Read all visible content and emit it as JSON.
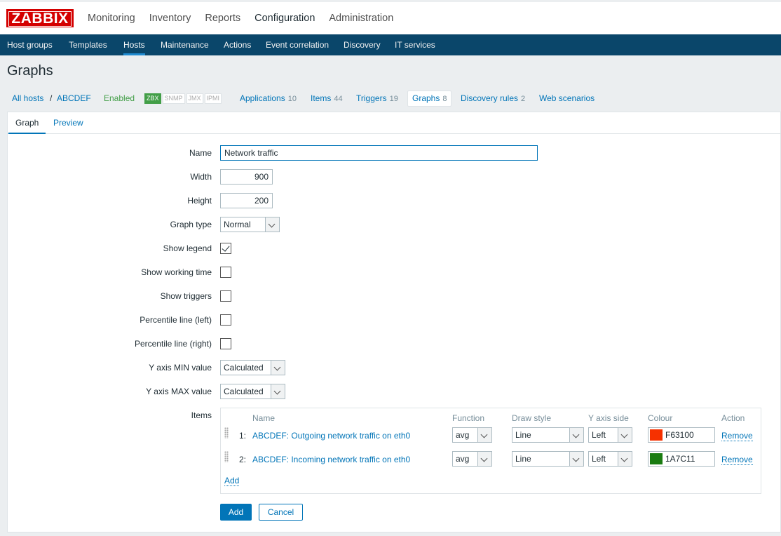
{
  "logo": "ZABBIX",
  "main_menu": [
    "Monitoring",
    "Inventory",
    "Reports",
    "Configuration",
    "Administration"
  ],
  "sub_menu": [
    "Host groups",
    "Templates",
    "Hosts",
    "Maintenance",
    "Actions",
    "Event correlation",
    "Discovery",
    "IT services"
  ],
  "page_title": "Graphs",
  "host_nav": {
    "all_hosts": "All hosts",
    "separator": "/",
    "host": "ABCDEF",
    "status": "Enabled",
    "badges": [
      "ZBX",
      "SNMP",
      "JMX",
      "IPMI"
    ],
    "applications": {
      "label": "Applications",
      "count": "10"
    },
    "items": {
      "label": "Items",
      "count": "44"
    },
    "triggers": {
      "label": "Triggers",
      "count": "19"
    },
    "graphs": {
      "label": "Graphs",
      "count": "8"
    },
    "discovery": {
      "label": "Discovery rules",
      "count": "2"
    },
    "web": {
      "label": "Web scenarios"
    }
  },
  "tabs": [
    "Graph",
    "Preview"
  ],
  "form": {
    "name_label": "Name",
    "name_value": "Network traffic",
    "width_label": "Width",
    "width_value": "900",
    "height_label": "Height",
    "height_value": "200",
    "graph_type_label": "Graph type",
    "graph_type_value": "Normal",
    "show_legend_label": "Show legend",
    "show_legend": true,
    "show_working_time_label": "Show working time",
    "show_working_time": false,
    "show_triggers_label": "Show triggers",
    "show_triggers": false,
    "percentile_left_label": "Percentile line (left)",
    "percentile_left": false,
    "percentile_right_label": "Percentile line (right)",
    "percentile_right": false,
    "ymin_label": "Y axis MIN value",
    "ymin_value": "Calculated",
    "ymax_label": "Y axis MAX value",
    "ymax_value": "Calculated",
    "items_label": "Items"
  },
  "items_table": {
    "headers": [
      "Name",
      "Function",
      "Draw style",
      "Y axis side",
      "Colour",
      "Action"
    ],
    "rows": [
      {
        "num": "1:",
        "name": "ABCDEF: Outgoing network traffic on eth0",
        "function": "avg",
        "draw_style": "Line",
        "y_axis_side": "Left",
        "colour": "F63100",
        "colour_hex": "#F63100",
        "action": "Remove"
      },
      {
        "num": "2:",
        "name": "ABCDEF: Incoming network traffic on eth0",
        "function": "avg",
        "draw_style": "Line",
        "y_axis_side": "Left",
        "colour": "1A7C11",
        "colour_hex": "#1A7C11",
        "action": "Remove"
      }
    ],
    "add_link": "Add"
  },
  "buttons": {
    "add": "Add",
    "cancel": "Cancel"
  }
}
